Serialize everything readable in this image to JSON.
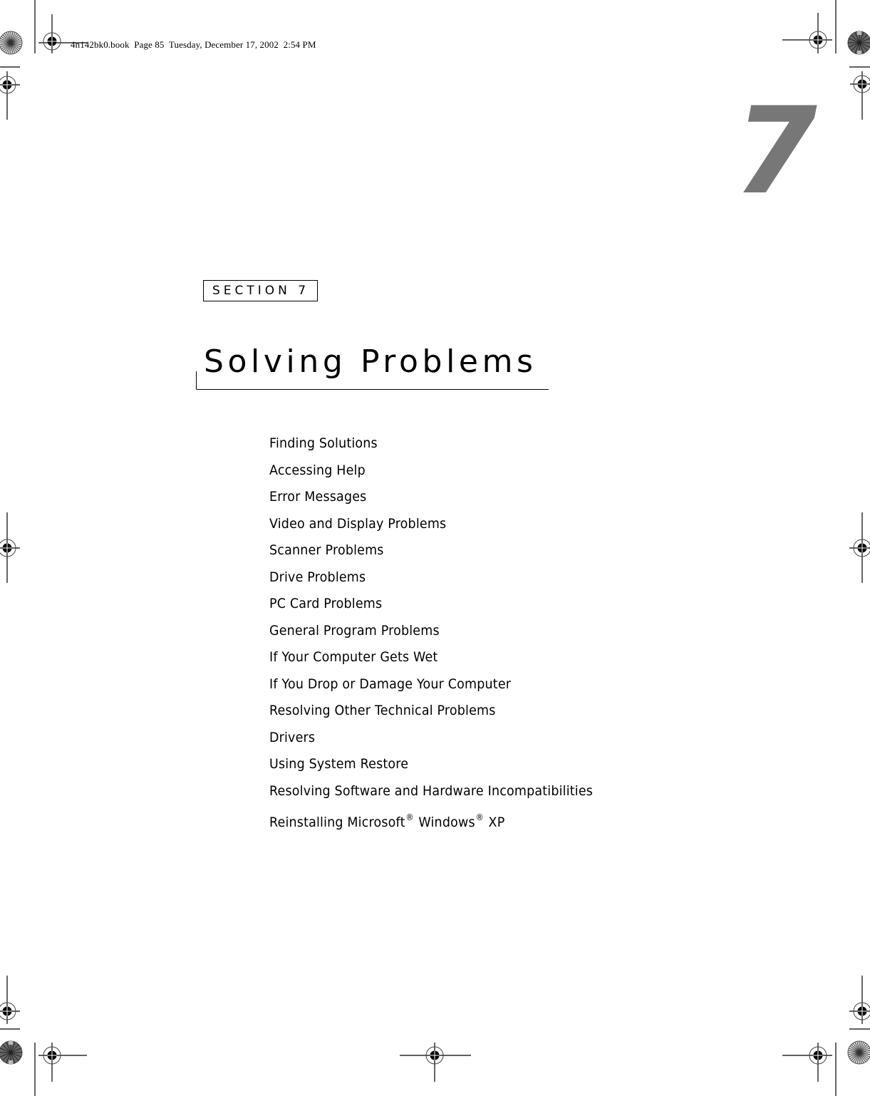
{
  "slug": "4n142bk0.book  Page 85  Tuesday, December 17, 2002  2:54 PM",
  "chapter_number": "7",
  "section_label": "SECTION 7",
  "chapter_title": "Solving Problems",
  "topics": [
    {
      "text": "Finding Solutions"
    },
    {
      "text": "Accessing Help"
    },
    {
      "text": "Error Messages"
    },
    {
      "text": "Video and Display Problems"
    },
    {
      "text": "Scanner Problems"
    },
    {
      "text": "Drive Problems"
    },
    {
      "text": "PC Card Problems"
    },
    {
      "text": "General Program Problems"
    },
    {
      "text": "If Your Computer Gets Wet"
    },
    {
      "text": "If You Drop or Damage Your Computer"
    },
    {
      "text": "Resolving Other Technical Problems"
    },
    {
      "text": "Drivers"
    },
    {
      "text": "Using System Restore"
    },
    {
      "text": "Resolving Software and Hardware Incompatibilities"
    },
    {
      "parts": [
        "Reinstalling Microsoft",
        "®",
        " Windows",
        "®",
        " XP"
      ]
    }
  ],
  "colors": {
    "chapter_number": "#777777",
    "text": "#000000"
  }
}
